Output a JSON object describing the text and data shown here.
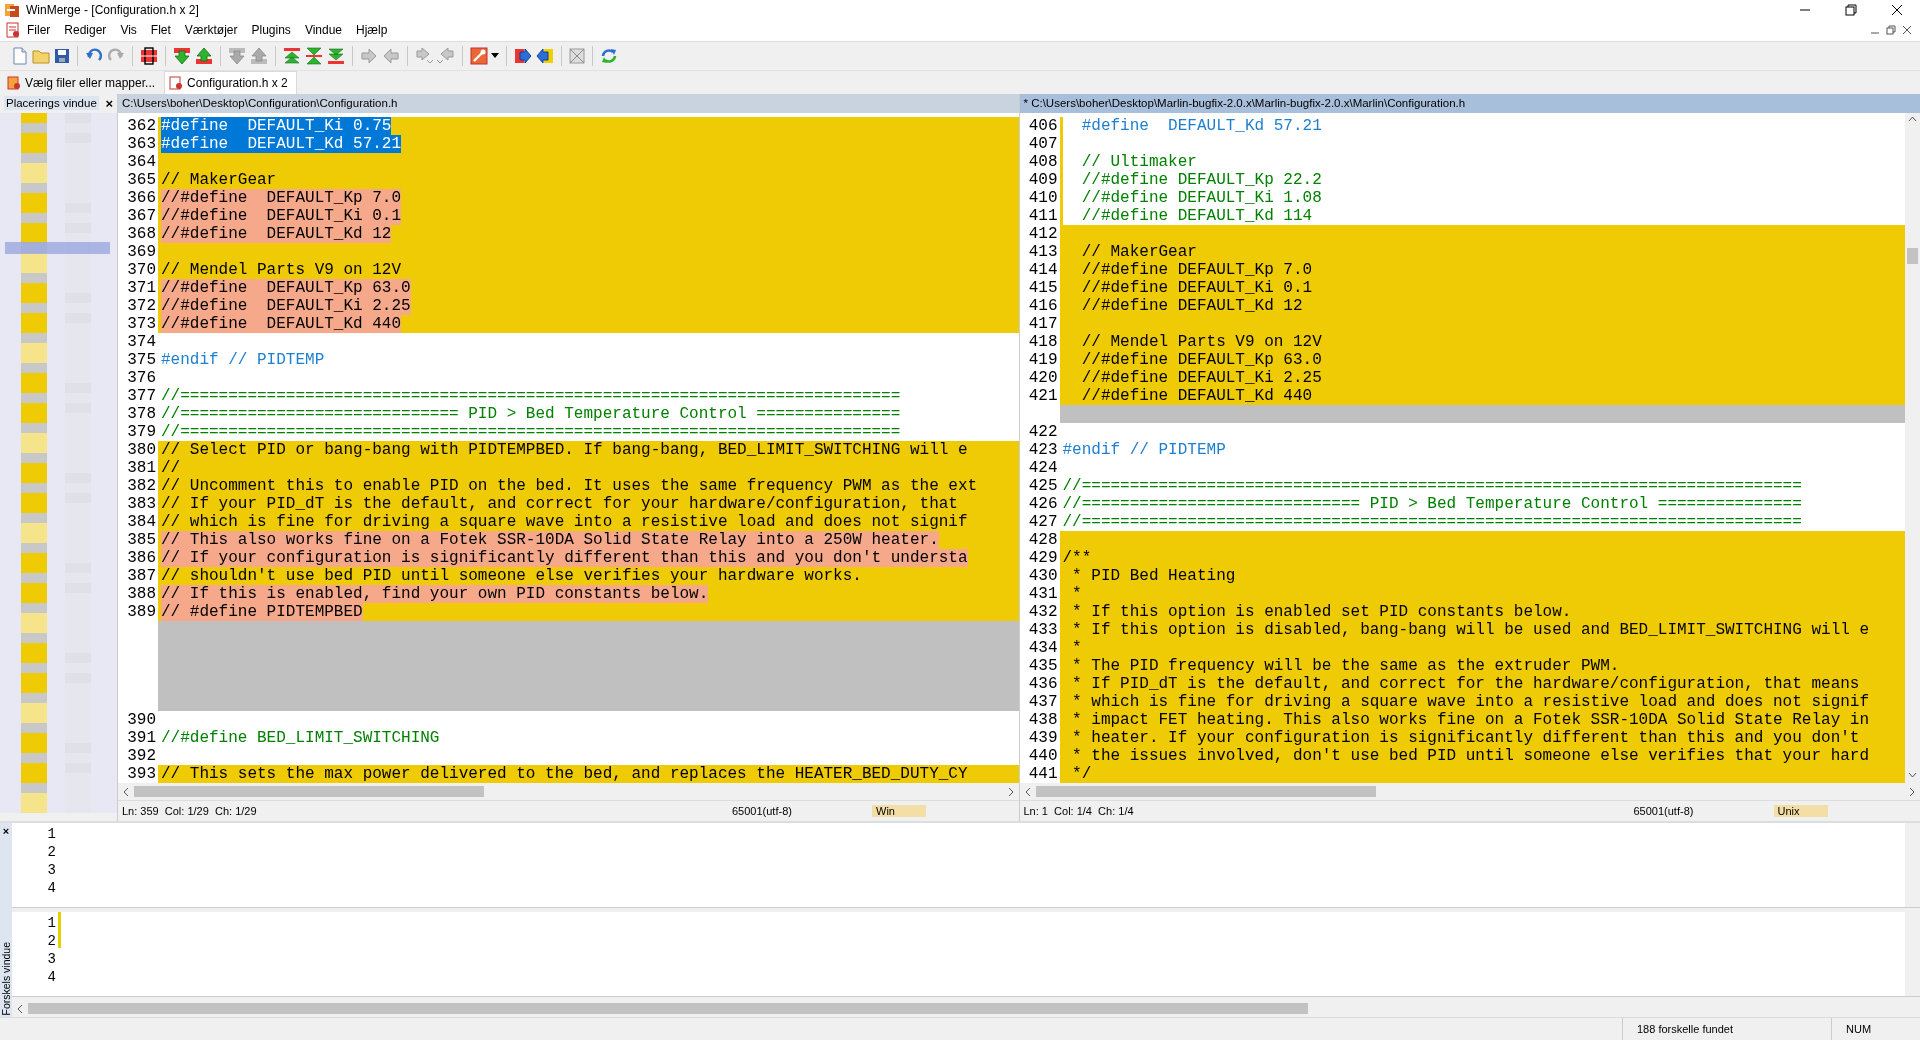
{
  "window": {
    "title": "WinMerge - [Configuration.h x 2]"
  },
  "menu": [
    "Filer",
    "Rediger",
    "Vis",
    "Flet",
    "Værktøjer",
    "Plugins",
    "Vindue",
    "Hjælp"
  ],
  "tabs": [
    {
      "label": "Vælg filer eller mapper...",
      "selected": false
    },
    {
      "label": "Configuration.h x 2",
      "selected": true
    }
  ],
  "location_pane": {
    "title": "Placerings vindue",
    "close": "×"
  },
  "panes": [
    {
      "path": "C:\\Users\\boher\\Desktop\\Configuration\\Configuration.h",
      "active": false,
      "scrollbar": false,
      "status": {
        "position": "Ln: 359  Col: 1/29  Ch: 1/29",
        "encoding": "65001(utf-8)",
        "eol": "Win"
      },
      "lines": [
        {
          "no": "362",
          "text": "#define  DEFAULT_Ki 0.75",
          "kind": "selected"
        },
        {
          "no": "363",
          "text": "#define  DEFAULT_Kd 57.21",
          "kind": "selected"
        },
        {
          "no": "364",
          "kind": "diff"
        },
        {
          "no": "365",
          "text": "// MakerGear",
          "kind": "diff"
        },
        {
          "no": "366",
          "text": "//#define  DEFAULT_Kp 7.0",
          "kind": "changed"
        },
        {
          "no": "367",
          "text": "//#define  DEFAULT_Ki 0.1",
          "kind": "changed"
        },
        {
          "no": "368",
          "text": "//#define  DEFAULT_Kd 12",
          "kind": "changed"
        },
        {
          "no": "369",
          "kind": "diff"
        },
        {
          "no": "370",
          "text": "// Mendel Parts V9 on 12V",
          "kind": "diff"
        },
        {
          "no": "371",
          "text": "//#define  DEFAULT_Kp 63.0",
          "kind": "changed"
        },
        {
          "no": "372",
          "text": "//#define  DEFAULT_Ki 2.25",
          "kind": "changed"
        },
        {
          "no": "373",
          "text": "//#define  DEFAULT_Kd 440",
          "kind": "changed"
        },
        {
          "no": "374",
          "kind": "same"
        },
        {
          "no": "375",
          "text": "#endif // PIDTEMP",
          "kind": "same",
          "color": "#1e7fd0"
        },
        {
          "no": "376",
          "kind": "same"
        },
        {
          "no": "377",
          "text": "//===========================================================================",
          "kind": "same",
          "color": "#008000"
        },
        {
          "no": "378",
          "text": "//============================= PID > Bed Temperature Control ===============",
          "kind": "same",
          "color": "#008000"
        },
        {
          "no": "379",
          "text": "//===========================================================================",
          "kind": "same",
          "color": "#008000"
        },
        {
          "no": "380",
          "text": "// Select PID or bang-bang with PIDTEMPBED. If bang-bang, BED_LIMIT_SWITCHING will e",
          "kind": "diff"
        },
        {
          "no": "381",
          "text": "//",
          "kind": "diff"
        },
        {
          "no": "382",
          "text": "// Uncomment this to enable PID on the bed. It uses the same frequency PWM as the ext",
          "kind": "diff"
        },
        {
          "no": "383",
          "text": "// If your PID_dT is the default, and correct for your hardware/configuration, that",
          "kind": "diff"
        },
        {
          "no": "384",
          "text": "// which is fine for driving a square wave into a resistive load and does not signif",
          "kind": "diff"
        },
        {
          "no": "385",
          "text": "// This also works fine on a Fotek SSR-10DA Solid State Relay into a 250W heater.",
          "kind": "changed"
        },
        {
          "no": "386",
          "text": "// If your configuration is significantly different than this and you don't understa",
          "kind": "changed"
        },
        {
          "no": "387",
          "text": "// shouldn't use bed PID until someone else verifies your hardware works.",
          "kind": "diff"
        },
        {
          "no": "388",
          "text": "// If this is enabled, find your own PID constants below.",
          "kind": "changed"
        },
        {
          "no": "389",
          "text": "// #define PIDTEMPBED",
          "kind": "changed"
        },
        {
          "kind": "gap"
        },
        {
          "kind": "gap"
        },
        {
          "kind": "gap"
        },
        {
          "kind": "gap"
        },
        {
          "kind": "gap"
        },
        {
          "no": "390",
          "kind": "same"
        },
        {
          "no": "391",
          "text": "//#define BED_LIMIT_SWITCHING",
          "kind": "same",
          "color": "#008000"
        },
        {
          "no": "392",
          "kind": "same"
        },
        {
          "no": "393",
          "text": "// This sets the max power delivered to the bed, and replaces the HEATER_BED_DUTY_CY",
          "kind": "diff"
        }
      ]
    },
    {
      "path": "* C:\\Users\\boher\\Desktop\\Marlin-bugfix-2.0.x\\Marlin-bugfix-2.0.x\\Marlin\\Configuration.h",
      "active": true,
      "scrollbar": true,
      "status": {
        "position": "Ln: 1  Col: 1/4  Ch: 1/4",
        "encoding": "65001(utf-8)",
        "eol": "Unix"
      },
      "lines": [
        {
          "no": "406",
          "text": "  #define  DEFAULT_Kd 57.21",
          "kind": "moved",
          "color": "#1e7fd0"
        },
        {
          "no": "407",
          "kind": "moved"
        },
        {
          "no": "408",
          "text": "  // Ultimaker",
          "kind": "moved",
          "color": "#008000"
        },
        {
          "no": "409",
          "text": "  //#define DEFAULT_Kp 22.2",
          "kind": "moved",
          "color": "#008000"
        },
        {
          "no": "410",
          "text": "  //#define DEFAULT_Ki 1.08",
          "kind": "moved",
          "color": "#008000"
        },
        {
          "no": "411",
          "text": "  //#define DEFAULT_Kd 114",
          "kind": "moved",
          "color": "#008000"
        },
        {
          "no": "412",
          "kind": "diff"
        },
        {
          "no": "413",
          "text": "  // MakerGear",
          "kind": "diff"
        },
        {
          "no": "414",
          "text": "  //#define DEFAULT_Kp 7.0",
          "kind": "diff"
        },
        {
          "no": "415",
          "text": "  //#define DEFAULT_Ki 0.1",
          "kind": "diff"
        },
        {
          "no": "416",
          "text": "  //#define DEFAULT_Kd 12",
          "kind": "diff"
        },
        {
          "no": "417",
          "kind": "diff"
        },
        {
          "no": "418",
          "text": "  // Mendel Parts V9 on 12V",
          "kind": "diff"
        },
        {
          "no": "419",
          "text": "  //#define DEFAULT_Kp 63.0",
          "kind": "diff"
        },
        {
          "no": "420",
          "text": "  //#define DEFAULT_Ki 2.25",
          "kind": "diff"
        },
        {
          "no": "421",
          "text": "  //#define DEFAULT_Kd 440",
          "kind": "diff"
        },
        {
          "kind": "gap"
        },
        {
          "no": "422",
          "kind": "same"
        },
        {
          "no": "423",
          "text": "#endif // PIDTEMP",
          "kind": "same",
          "color": "#1e7fd0"
        },
        {
          "no": "424",
          "kind": "same"
        },
        {
          "no": "425",
          "text": "//===========================================================================",
          "kind": "same",
          "color": "#008000"
        },
        {
          "no": "426",
          "text": "//============================= PID > Bed Temperature Control ===============",
          "kind": "same",
          "color": "#008000"
        },
        {
          "no": "427",
          "text": "//===========================================================================",
          "kind": "same",
          "color": "#008000"
        },
        {
          "no": "428",
          "kind": "diff"
        },
        {
          "no": "429",
          "text": "/**",
          "kind": "diff"
        },
        {
          "no": "430",
          "text": " * PID Bed Heating",
          "kind": "diff"
        },
        {
          "no": "431",
          "text": " *",
          "kind": "diff"
        },
        {
          "no": "432",
          "text": " * If this option is enabled set PID constants below.",
          "kind": "diff"
        },
        {
          "no": "433",
          "text": " * If this option is disabled, bang-bang will be used and BED_LIMIT_SWITCHING will e",
          "kind": "diff"
        },
        {
          "no": "434",
          "text": " *",
          "kind": "diff"
        },
        {
          "no": "435",
          "text": " * The PID frequency will be the same as the extruder PWM.",
          "kind": "diff"
        },
        {
          "no": "436",
          "text": " * If PID_dT is the default, and correct for the hardware/configuration, that means",
          "kind": "diff"
        },
        {
          "no": "437",
          "text": " * which is fine for driving a square wave into a resistive load and does not signif",
          "kind": "diff"
        },
        {
          "no": "438",
          "text": " * impact FET heating. This also works fine on a Fotek SSR-10DA Solid State Relay in",
          "kind": "diff"
        },
        {
          "no": "439",
          "text": " * heater. If your configuration is significantly different than this and you don't",
          "kind": "diff"
        },
        {
          "no": "440",
          "text": " * the issues involved, don't use bed PID until someone else verifies that your hard",
          "kind": "diff"
        },
        {
          "no": "441",
          "text": " */",
          "kind": "diff"
        }
      ]
    }
  ],
  "diff_pane": {
    "title": "Forskels vindue",
    "close": "×",
    "upper_lines": [
      "1",
      "2",
      "3",
      "4"
    ],
    "lower_lines": [
      "1",
      "2",
      "3",
      "4"
    ]
  },
  "status_bar": {
    "message": "188 forskelle fundet",
    "num": "NUM"
  }
}
